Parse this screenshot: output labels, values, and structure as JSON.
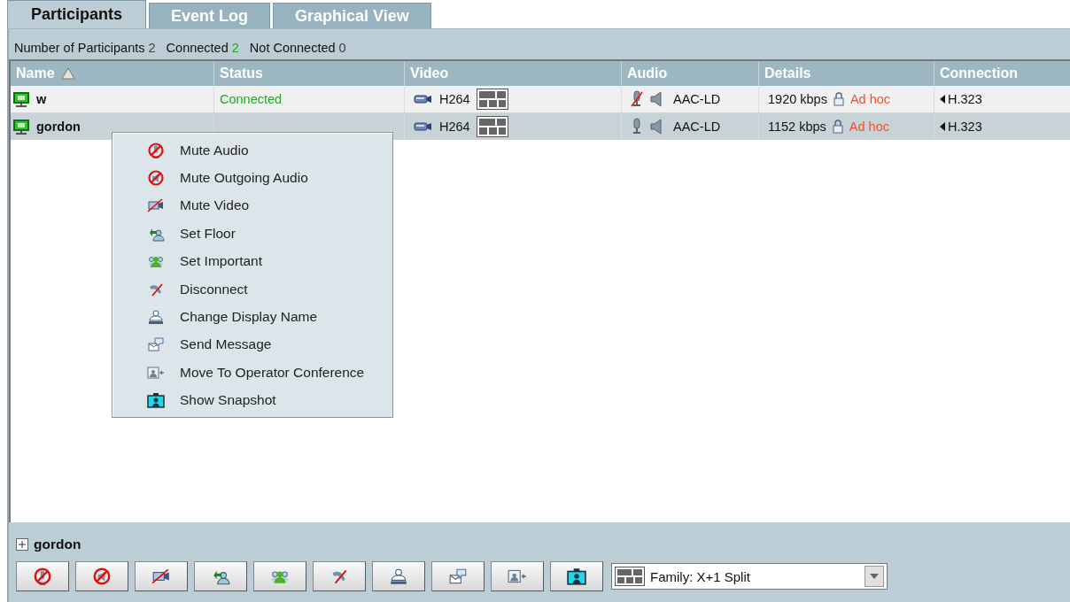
{
  "tabs": [
    {
      "label": "Participants",
      "selected": true
    },
    {
      "label": "Event Log",
      "selected": false
    },
    {
      "label": "Graphical View",
      "selected": false
    }
  ],
  "summary": [
    {
      "label": "Number of Participants",
      "value": "2",
      "kind": "plain"
    },
    {
      "label": "Connected",
      "value": "2",
      "kind": "good"
    },
    {
      "label": "Not Connected",
      "value": "0",
      "kind": "plain"
    }
  ],
  "table": {
    "columns": [
      {
        "label": "Name",
        "sorted": true
      },
      {
        "label": "Status",
        "sorted": false
      },
      {
        "label": "Video",
        "sorted": false
      },
      {
        "label": "Audio",
        "sorted": false
      },
      {
        "label": "Details",
        "sorted": false
      },
      {
        "label": "Connection",
        "sorted": false
      }
    ],
    "rows": [
      {
        "name": "w",
        "selected": false,
        "status": "Connected",
        "connected": true,
        "video": "H264",
        "audio_muted": true,
        "audio": "AAC-LD",
        "details": "1920 kbps",
        "conference": "Ad hoc",
        "connection": "H.323"
      },
      {
        "name": "gordon",
        "selected": true,
        "video": "H264",
        "audio_muted": false,
        "audio": "AAC-LD",
        "details": "1152 kbps",
        "conference": "Ad hoc",
        "connection": "H.323"
      }
    ]
  },
  "context_menu": {
    "items": [
      {
        "label": "Mute Audio",
        "kind": "mute-audio"
      },
      {
        "label": "Mute Outgoing Audio",
        "kind": "mute-outgoing"
      },
      {
        "label": "Mute Video",
        "kind": "mute-video"
      },
      {
        "label": "Set Floor",
        "kind": "set-floor"
      },
      {
        "label": "Set Important",
        "kind": "set-important"
      },
      {
        "label": "Disconnect",
        "kind": "disconnect"
      },
      {
        "label": "Change Display Name",
        "kind": "change-name"
      },
      {
        "label": "Send Message",
        "kind": "send-message"
      },
      {
        "label": "Move To Operator Conference",
        "kind": "move-operator"
      },
      {
        "label": "Show Snapshot",
        "kind": "snapshot"
      }
    ]
  },
  "selected_participant": {
    "name": "gordon",
    "expanded": false
  },
  "action_buttons": [
    {
      "kind": "mute-audio"
    },
    {
      "kind": "mute-outgoing"
    },
    {
      "kind": "mute-video"
    },
    {
      "kind": "set-floor"
    },
    {
      "kind": "set-important"
    },
    {
      "kind": "disconnect"
    },
    {
      "kind": "change-name"
    },
    {
      "kind": "send-message"
    },
    {
      "kind": "move-operator"
    },
    {
      "kind": "snapshot"
    }
  ],
  "layout_dropdown": {
    "value": "Family: X+1 Split"
  }
}
